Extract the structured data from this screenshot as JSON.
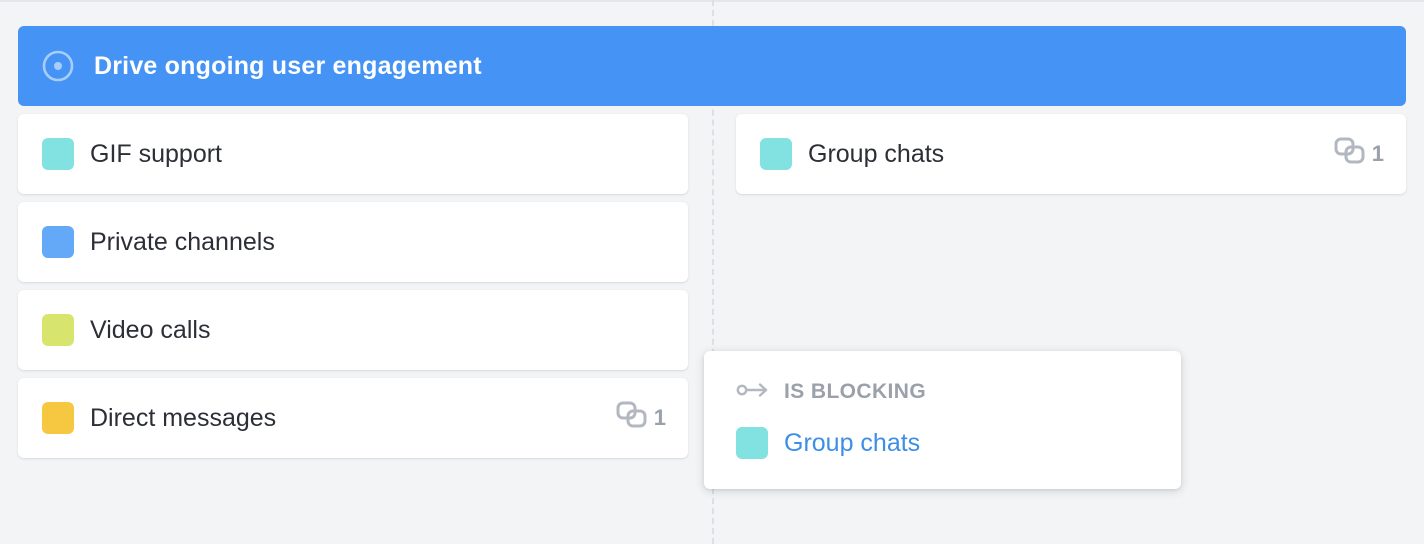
{
  "goal": {
    "title": "Drive ongoing user engagement",
    "icon": "target-icon",
    "color": "#4593f5"
  },
  "left_column": [
    {
      "label": "GIF support",
      "color": "#82e2e2"
    },
    {
      "label": "Private channels",
      "color": "#64a8f8"
    },
    {
      "label": "Video calls",
      "color": "#d7e56e"
    },
    {
      "label": "Direct messages",
      "color": "#f6c841",
      "dependencies": "1",
      "dependency_icon": "link-icon"
    }
  ],
  "right_column": [
    {
      "label": "Group chats",
      "color": "#82e2e2",
      "dependencies": "1",
      "dependency_icon": "link-icon"
    }
  ],
  "popover": {
    "heading": "IS BLOCKING",
    "heading_icon": "blocking-arrow-icon",
    "item": {
      "label": "Group chats",
      "color": "#82e2e2"
    }
  }
}
